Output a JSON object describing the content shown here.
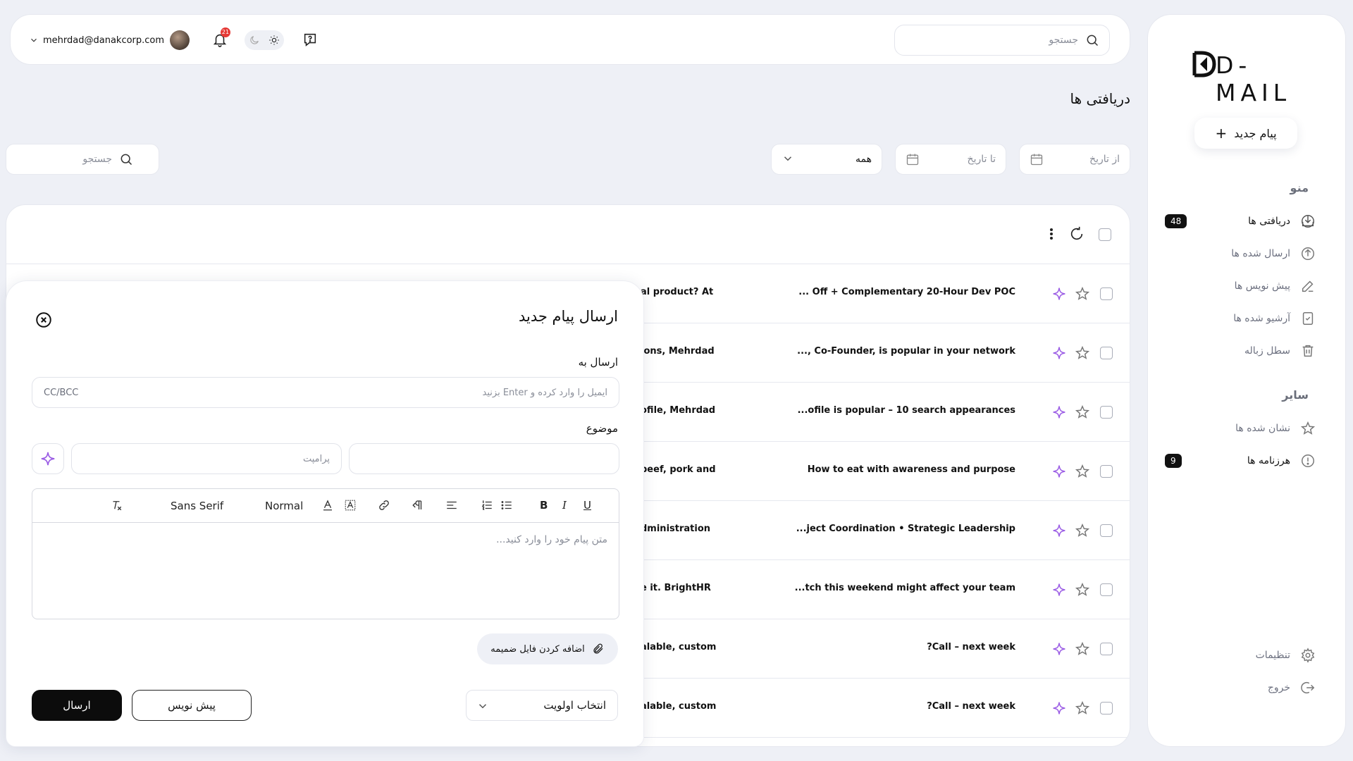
{
  "sidebar": {
    "logo": "D-MAIL",
    "new_message": "پیام جدید",
    "menu_title": "منو",
    "items": [
      {
        "label": "دریافتی ها",
        "badge": "48"
      },
      {
        "label": "ارسال شده ها"
      },
      {
        "label": "پیش نویس ها"
      },
      {
        "label": "آرشیو شده ها"
      },
      {
        "label": "سطل زباله"
      }
    ],
    "other_title": "سایر",
    "other_items": [
      {
        "label": "نشان شده ها"
      },
      {
        "label": "هرزنامه ها",
        "badge": "9"
      }
    ],
    "settings": "تنظیمات",
    "logout": "خروج"
  },
  "header": {
    "search_placeholder": "جستجو",
    "user_email": "mehrdad@danakcorp.com",
    "notification_count": "21"
  },
  "page": {
    "title": "دریافتی ها",
    "from_date": "از تاریخ",
    "to_date": "تا تاریخ",
    "filter_value": "همه",
    "search_placeholder": "جستجو"
  },
  "emails": [
    {
      "subject": "... Off + Complementary 20-Hour Dev POC",
      "snippet": "al product? At"
    },
    {
      "subject": "..., Co-Founder, is popular in your network",
      "snippet": "ions, Mehrdad"
    },
    {
      "subject": "...ofile is popular – 10 search appearances",
      "snippet": "ofile, Mehrdad"
    },
    {
      "subject": "How to eat with awareness and purpose",
      "snippet": "beef, pork and"
    },
    {
      "subject": "...ject Coordination • Strategic Leadership",
      "snippet": "dministration"
    },
    {
      "subject": "...tch this weekend might affect your team",
      "snippet": "e it. BrightHR"
    },
    {
      "subject": "?Call – next week",
      "snippet": "alable, custom"
    },
    {
      "subject": "?Call – next week",
      "snippet": "alable, custom"
    }
  ],
  "compose": {
    "title": "ارسال پیام جدید",
    "to_label": "ارسال به",
    "to_placeholder": "ایمیل را وارد کرده و Enter بزنید",
    "cc_bcc": "CC/BCC",
    "subject_label": "موضوع",
    "prompt_placeholder": "پرامپت",
    "toolbar_font": "Sans Serif",
    "toolbar_size": "Normal",
    "body_placeholder": "متن پیام خود را وارد کنید...",
    "attach": "اضافه کردن فایل ضمیمه",
    "priority": "انتخاب اولویت",
    "draft": "پیش نویس",
    "send": "ارسال"
  },
  "colors": {
    "accent": "#0c0c0c",
    "spark": "#9b5de5",
    "badge": "#111111",
    "notification": "#e53935"
  }
}
